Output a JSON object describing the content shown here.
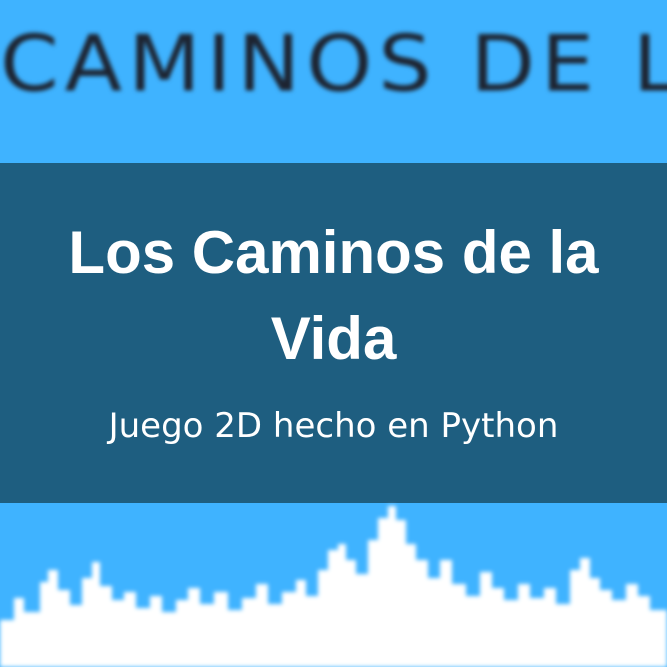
{
  "logo": {
    "text": "CAMINOS DE LA"
  },
  "banner": {
    "title": "Los Caminos de la Vida",
    "subtitle": "Juego 2D hecho en Python"
  },
  "colors": {
    "sky": "#3fb3ff",
    "banner": "#1e5e80",
    "text": "#ffffff",
    "logo_ink": "#1d2330"
  }
}
